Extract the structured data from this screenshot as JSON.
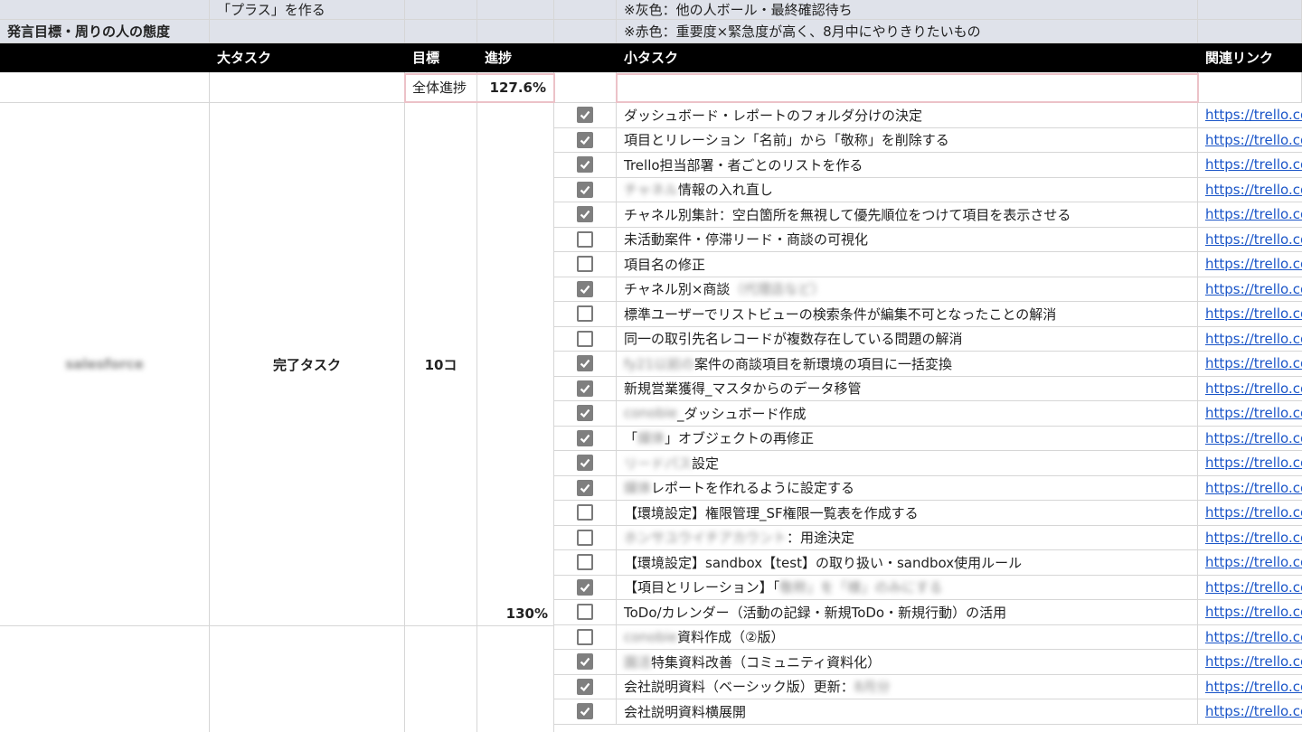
{
  "top_rows": [
    {
      "col_b": "「プラス」を作る",
      "col_f": "※灰色：他の人ボール・最終確認待ち"
    },
    {
      "col_a": "発言目標・周りの人の態度",
      "col_f": "※赤色：重要度×緊急度が高く、8月中にやりきりたいもの"
    }
  ],
  "header": {
    "big_task": "大タスク",
    "goal": "目標",
    "progress": "進捗",
    "small_task": "小タスク",
    "related_link": "関連リンク"
  },
  "overall": {
    "label": "全体進捗",
    "value": "127.6%"
  },
  "group1": {
    "category": "salesforce",
    "big_task": "完了タスク",
    "goal": "10コ",
    "progress": "130%"
  },
  "link_text": "https://trello.co",
  "tasks": [
    {
      "checked": true,
      "text": "ダッシュボード・レポートのフォルダ分けの決定"
    },
    {
      "checked": true,
      "text": "項目とリレーション「名前」から「敬称」を削除する"
    },
    {
      "checked": true,
      "text": "Trello担当部署・者ごとのリストを作る"
    },
    {
      "checked": true,
      "blur": "チャネル",
      "text": "情報の入れ直し"
    },
    {
      "checked": true,
      "text": "チャネル別集計：空白箇所を無視して優先順位をつけて項目を表示させる"
    },
    {
      "checked": false,
      "text": "未活動案件・停滞リード・商談の可視化"
    },
    {
      "checked": false,
      "text": "項目名の修正"
    },
    {
      "checked": true,
      "text": "チャネル別×商談",
      "blur_after": "（代理店など）"
    },
    {
      "checked": false,
      "text": "標準ユーザーでリストビューの検索条件が編集不可となったことの解消"
    },
    {
      "checked": false,
      "text": "同一の取引先名レコードが複数存在している問題の解消"
    },
    {
      "checked": true,
      "blur": "fy21以前の",
      "text": "案件の商談項目を新環境の項目に一括変換"
    },
    {
      "checked": true,
      "text": "新規営業獲得_マスタからのデータ移管"
    },
    {
      "checked": true,
      "blur": "conobie",
      "text": "_ダッシュボード作成"
    },
    {
      "checked": true,
      "text": "「",
      "blur_mid": "媒体",
      "text_after": "」オブジェクトの再修正"
    },
    {
      "checked": true,
      "blur": "リードパス",
      "text": "設定"
    },
    {
      "checked": true,
      "blur": "媒体",
      "text": "レポートを作れるように設定する"
    },
    {
      "checked": false,
      "text": "【環境設定】権限管理_SF権限一覧表を作成する"
    },
    {
      "checked": false,
      "blur": "ホンサユウイチアカウント",
      "text": "：用途決定"
    },
    {
      "checked": false,
      "text": "【環境設定】sandbox【test】の取り扱い・sandbox使用ルール"
    },
    {
      "checked": true,
      "text": "【項目とリレーション】「",
      "blur_after": "敬称」を「様」のみにする"
    },
    {
      "checked": false,
      "text": "ToDo/カレンダー（活動の記録・新規ToDo・新規行動）の活用"
    },
    {
      "checked": false,
      "blur": "conobie",
      "text": "資料作成（②版）"
    },
    {
      "checked": true,
      "blur": "園活",
      "text": "特集資料改善（コミュニティ資料化）"
    },
    {
      "checked": true,
      "text": "会社説明資料（ベーシック版）更新：",
      "blur_after": "8月分"
    },
    {
      "checked": true,
      "text": "会社説明資料横展開"
    }
  ]
}
